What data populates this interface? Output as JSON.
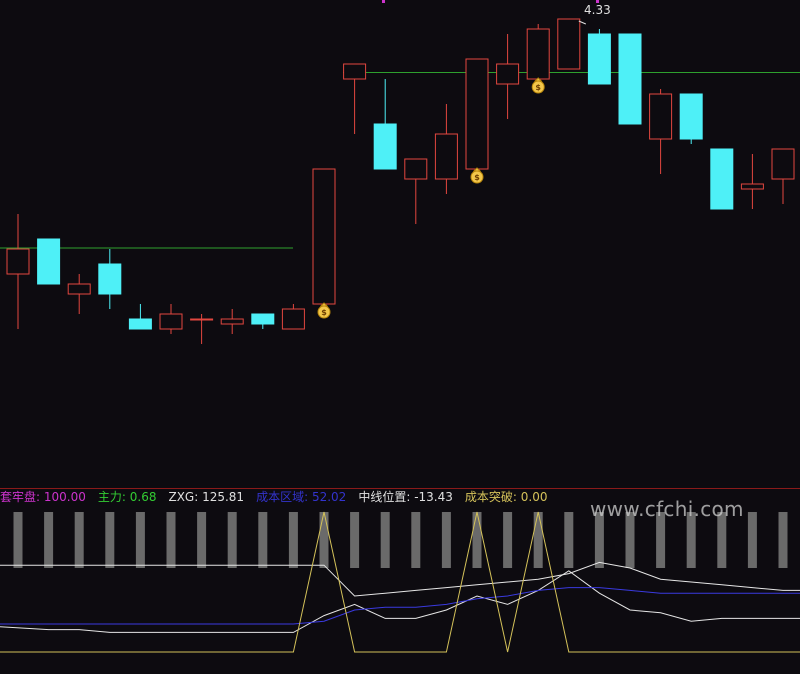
{
  "chart_data": [
    {
      "type": "candlestick",
      "candles": [
        {
          "o": 3.82,
          "h": 3.94,
          "l": 3.71,
          "c": 3.87
        },
        {
          "o": 3.89,
          "h": 3.89,
          "l": 3.8,
          "c": 3.8
        },
        {
          "o": 3.78,
          "h": 3.82,
          "l": 3.74,
          "c": 3.8
        },
        {
          "o": 3.84,
          "h": 3.87,
          "l": 3.75,
          "c": 3.78
        },
        {
          "o": 3.73,
          "h": 3.76,
          "l": 3.71,
          "c": 3.71
        },
        {
          "o": 3.71,
          "h": 3.76,
          "l": 3.7,
          "c": 3.74
        },
        {
          "o": 3.73,
          "h": 3.74,
          "l": 3.68,
          "c": 3.73
        },
        {
          "o": 3.72,
          "h": 3.75,
          "l": 3.7,
          "c": 3.73
        },
        {
          "o": 3.74,
          "h": 3.74,
          "l": 3.71,
          "c": 3.72
        },
        {
          "o": 3.71,
          "h": 3.76,
          "l": 3.71,
          "c": 3.75
        },
        {
          "o": 3.76,
          "h": 4.03,
          "l": 3.76,
          "c": 4.03
        },
        {
          "o": 4.21,
          "h": 4.24,
          "l": 4.1,
          "c": 4.24
        },
        {
          "o": 4.12,
          "h": 4.21,
          "l": 4.03,
          "c": 4.03
        },
        {
          "o": 4.01,
          "h": 4.04,
          "l": 3.92,
          "c": 4.05
        },
        {
          "o": 4.01,
          "h": 4.16,
          "l": 3.98,
          "c": 4.1
        },
        {
          "o": 4.03,
          "h": 4.25,
          "l": 4.03,
          "c": 4.25
        },
        {
          "o": 4.2,
          "h": 4.3,
          "l": 4.13,
          "c": 4.24
        },
        {
          "o": 4.21,
          "h": 4.32,
          "l": 4.21,
          "c": 4.31
        },
        {
          "o": 4.23,
          "h": 4.33,
          "l": 4.23,
          "c": 4.33
        },
        {
          "o": 4.3,
          "h": 4.31,
          "l": 4.2,
          "c": 4.2
        },
        {
          "o": 4.3,
          "h": 4.3,
          "l": 4.12,
          "c": 4.12
        },
        {
          "o": 4.09,
          "h": 4.19,
          "l": 4.02,
          "c": 4.18
        },
        {
          "o": 4.18,
          "h": 4.18,
          "l": 4.08,
          "c": 4.09
        },
        {
          "o": 4.07,
          "h": 4.07,
          "l": 3.95,
          "c": 3.95
        },
        {
          "o": 3.99,
          "h": 4.06,
          "l": 3.95,
          "c": 4.0
        },
        {
          "o": 4.01,
          "h": 4.06,
          "l": 3.96,
          "c": 4.07
        }
      ],
      "ylim": [
        3.4,
        4.36
      ],
      "reference_lines": [
        3.872,
        4.223
      ],
      "buy_markers": [
        10,
        15,
        17
      ],
      "peak_label": "4.33"
    },
    {
      "type": "line",
      "indicator_title": "",
      "legend": [
        {
          "name": "套牢盘",
          "value": "100.00",
          "color": "#cc33cc"
        },
        {
          "name": "主力",
          "value": "0.68",
          "color": "#33cc33"
        },
        {
          "name": "ZXG",
          "value": "125.81",
          "color": "#e0e0e0"
        },
        {
          "name": "成本区域",
          "value": "52.02",
          "color": "#3333cc"
        },
        {
          "name": "中线位置",
          "value": "-13.43",
          "color": "#e0e0e0"
        },
        {
          "name": "成本突破",
          "value": "0.00",
          "color": "#d4c25a"
        }
      ],
      "ylim": [
        0,
        100
      ],
      "bars": [
        100,
        100,
        100,
        100,
        100,
        100,
        100,
        100,
        100,
        100,
        100,
        100,
        100,
        100,
        100,
        100,
        100,
        100,
        100,
        100,
        100,
        100,
        100,
        100,
        100,
        100
      ],
      "series": [
        {
          "color": "#e6e6e6",
          "values": [
            62,
            62,
            62,
            62,
            62,
            62,
            62,
            62,
            62,
            62,
            62,
            40,
            42,
            44,
            46,
            48,
            50,
            52,
            56,
            64,
            60,
            52,
            50,
            48,
            46,
            44
          ]
        },
        {
          "color": "#e6e6e6",
          "values": [
            18,
            16,
            16,
            14,
            14,
            14,
            14,
            14,
            14,
            14,
            26,
            34,
            24,
            24,
            30,
            40,
            34,
            44,
            58,
            42,
            30,
            28,
            22,
            24,
            24,
            24
          ]
        },
        {
          "color": "#3a3ae0",
          "values": [
            20,
            20,
            20,
            20,
            20,
            20,
            20,
            20,
            20,
            20,
            22,
            30,
            32,
            32,
            34,
            38,
            40,
            44,
            46,
            46,
            44,
            42,
            42,
            42,
            42,
            42
          ]
        },
        {
          "color": "#d4c25a",
          "values": [
            0,
            0,
            0,
            0,
            0,
            0,
            0,
            0,
            0,
            0,
            100,
            0,
            0,
            0,
            0,
            100,
            0,
            100,
            0,
            0,
            0,
            0,
            0,
            0,
            0,
            0
          ]
        }
      ]
    }
  ],
  "watermark": "www.cfchi.com"
}
